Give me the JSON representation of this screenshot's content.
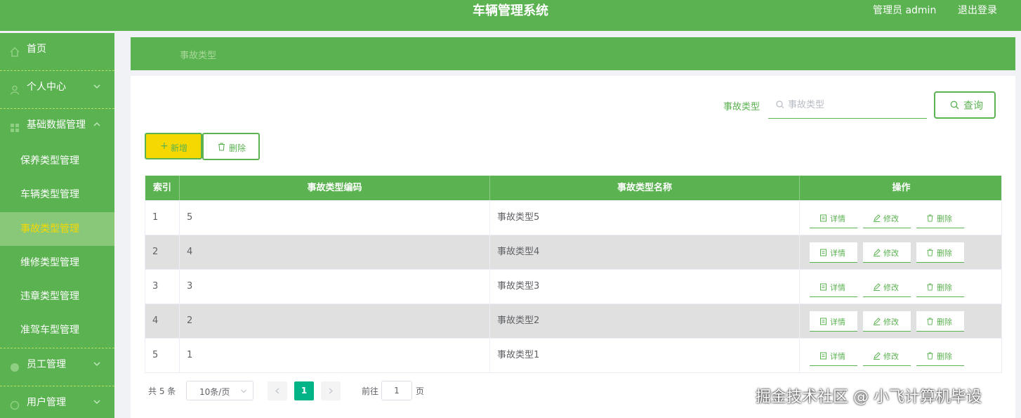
{
  "header": {
    "title": "车辆管理系统",
    "admin_label": "管理员 admin",
    "logout_label": "退出登录"
  },
  "sidebar": {
    "home": "首页",
    "personal_center": "个人中心",
    "base_data": "基础数据管理",
    "sub_items": [
      "保养类型管理",
      "车辆类型管理",
      "事故类型管理",
      "维修类型管理",
      "违章类型管理",
      "准驾车型管理"
    ],
    "staff": "员工管理",
    "users": "用户管理"
  },
  "breadcrumb": {
    "current": "事故类型"
  },
  "search": {
    "label": "事故类型",
    "placeholder": "事故类型",
    "query_label": "查询"
  },
  "actions": {
    "add_label": "新增",
    "delete_label": "删除"
  },
  "table": {
    "columns": [
      "索引",
      "事故类型编码",
      "事故类型名称",
      "操作"
    ],
    "rows": [
      {
        "index": "1",
        "code": "5",
        "name": "事故类型5"
      },
      {
        "index": "2",
        "code": "4",
        "name": "事故类型4"
      },
      {
        "index": "3",
        "code": "3",
        "name": "事故类型3"
      },
      {
        "index": "4",
        "code": "2",
        "name": "事故类型2"
      },
      {
        "index": "5",
        "code": "1",
        "name": "事故类型1"
      }
    ],
    "row_actions": {
      "detail": "详情",
      "edit": "修改",
      "delete": "删除"
    }
  },
  "pagination": {
    "total_label": "共 5 条",
    "page_size": "10条/页",
    "current_page": "1",
    "goto_label": "前往",
    "goto_value": "1",
    "page_unit": "页"
  },
  "watermark": "掘金技术社区 @ 小飞计算机毕设",
  "colors": {
    "primary": "#5bb251",
    "accent": "#f5d800",
    "page_active": "#00b487"
  }
}
